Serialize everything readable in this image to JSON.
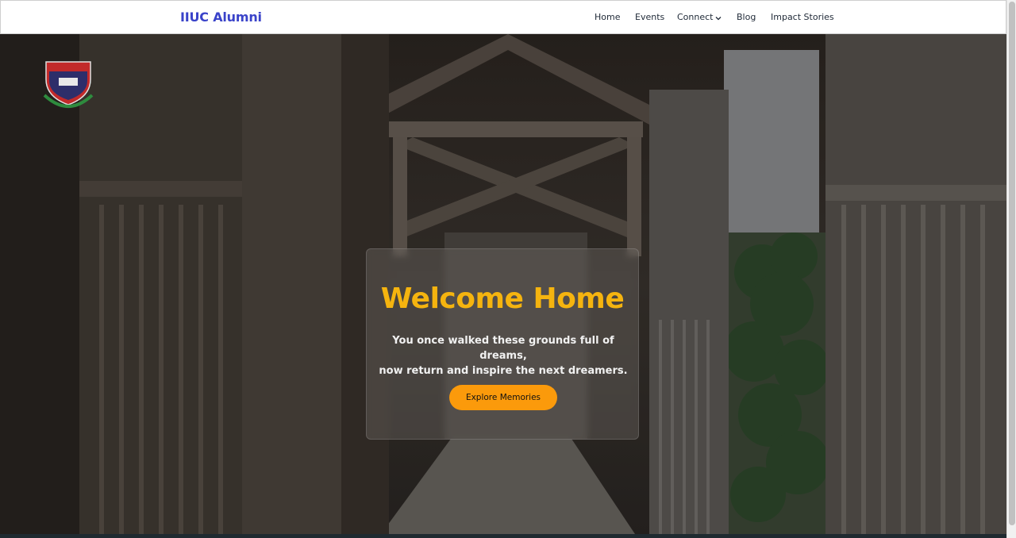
{
  "header": {
    "brand": "IIUC Alumni",
    "nav": [
      {
        "label": "Home"
      },
      {
        "label": "Events"
      },
      {
        "label": "Connect"
      },
      {
        "label": "Blog"
      },
      {
        "label": "Impact Stories"
      }
    ]
  },
  "hero": {
    "logo_text": "IIUC",
    "title": "Welcome Home",
    "subtitle_line1": "You once walked these grounds full of dreams,",
    "subtitle_line2": "now return and inspire the next dreamers.",
    "cta_label": "Explore Memories"
  },
  "icons": {
    "connect_dropdown": "chevron-down-icon",
    "logo": "iiuc-crest-logo"
  },
  "colors": {
    "brand": "#3a43c9",
    "title": "#f5b40f",
    "cta": "#fb9a0b",
    "nav_text": "#1f2937"
  }
}
